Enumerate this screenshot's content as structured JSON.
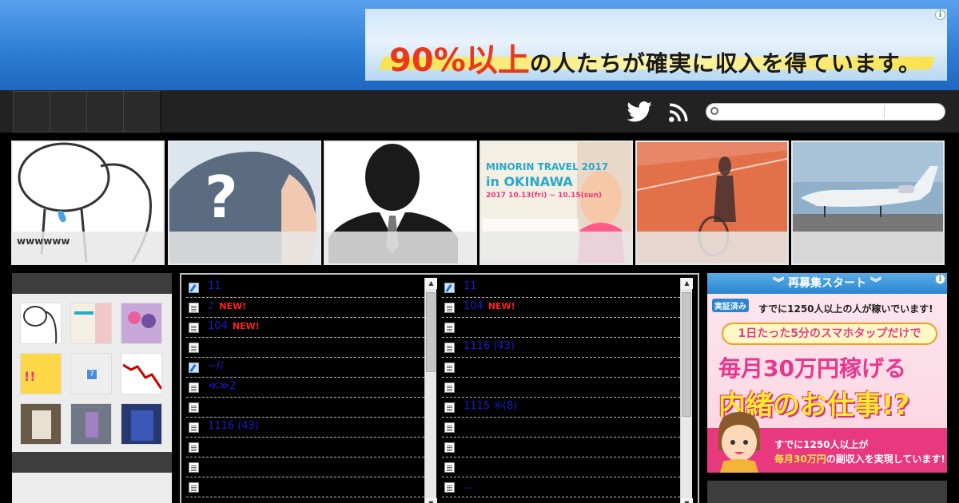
{
  "header": {
    "ad_big": "90%以上",
    "ad_rest": "の人たちが確実に収入を得ています。"
  },
  "nav": {
    "tabs": [
      "",
      "",
      "",
      ""
    ],
    "search_placeholder": ""
  },
  "thumbnails": [
    {
      "caption": "wwwwww"
    },
    {
      "caption": ""
    },
    {
      "caption": ""
    },
    {
      "caption": ""
    },
    {
      "caption": ""
    },
    {
      "caption": ""
    }
  ],
  "thumb_texts": {
    "minorin_title": "MINORIN TRAVEL 2017",
    "minorin_sub": "in OKINAWA",
    "minorin_date": "2017 10.13(fri) ~ 10.15(sun)"
  },
  "feed": {
    "left": [
      {
        "icon": "feather",
        "text": "11",
        "new": ""
      },
      {
        "icon": "doc",
        "text": "♪",
        "new": "NEW!"
      },
      {
        "icon": "doc",
        "text": "104",
        "new": "NEW!"
      },
      {
        "icon": "doc",
        "text": "",
        "new": ""
      },
      {
        "icon": "feather",
        "text": "~//",
        "new": ""
      },
      {
        "icon": "doc",
        "text": "≪≫2",
        "new": ""
      },
      {
        "icon": "doc",
        "text": "",
        "new": ""
      },
      {
        "icon": "doc",
        "text": "1116 (43)",
        "new": ""
      },
      {
        "icon": "doc",
        "text": "",
        "new": ""
      },
      {
        "icon": "doc",
        "text": "",
        "new": ""
      },
      {
        "icon": "doc",
        "text": "",
        "new": ""
      }
    ],
    "right": [
      {
        "icon": "feather",
        "text": "11",
        "new": ""
      },
      {
        "icon": "doc",
        "text": "104",
        "new": "NEW!"
      },
      {
        "icon": "doc",
        "text": "",
        "new": ""
      },
      {
        "icon": "doc",
        "text": "1116 (43)",
        "new": ""
      },
      {
        "icon": "doc",
        "text": "",
        "new": ""
      },
      {
        "icon": "doc",
        "text": "",
        "new": ""
      },
      {
        "icon": "doc",
        "text": "1115 ④(8)",
        "new": ""
      },
      {
        "icon": "doc",
        "text": "",
        "new": ""
      },
      {
        "icon": "doc",
        "text": "",
        "new": ""
      },
      {
        "icon": "doc",
        "text": "",
        "new": ""
      },
      {
        "icon": "doc",
        "text": "...",
        "new": ""
      }
    ]
  },
  "right_ad": {
    "banner": "︾  再募集スタート  ︾",
    "verified": "実証済み",
    "sub": "すでに1250人以上の人が稼いでいます!",
    "pill": "1日たった5分のスマホタップだけで",
    "head1": "毎月30万円稼げる",
    "head2": "内緒のお仕事!?",
    "foot1": "すでに1250人以上が",
    "foot2_hl": "毎月30万円",
    "foot2_rest": "の副収入を実現しています!"
  }
}
